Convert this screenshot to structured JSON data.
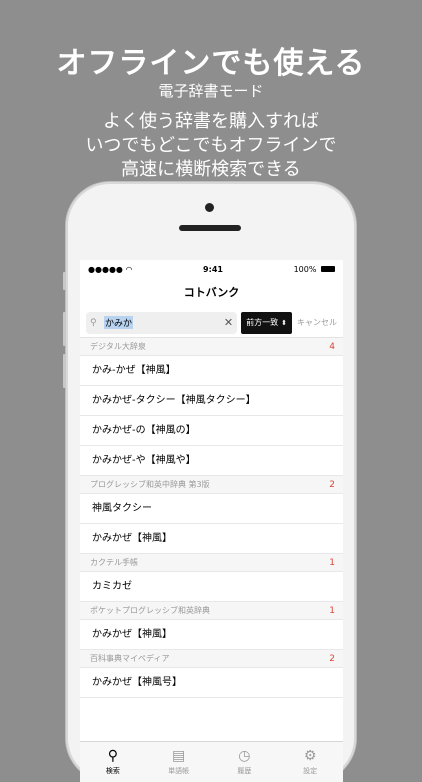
{
  "promo": {
    "headline": "オフラインでも使える",
    "subhead": "電子辞書モード",
    "desc_lines": [
      "よく使う辞書を購入すれば",
      "いつでもどこでもオフラインで",
      "高速に横断検索できる"
    ]
  },
  "status": {
    "time": "9:41",
    "battery": "100%"
  },
  "app": {
    "title": "コトバンク"
  },
  "search": {
    "query": "かみか",
    "mode": "前方一致",
    "cancel": "キャンセル"
  },
  "sections": [
    {
      "name": "デジタル大辞泉",
      "count": "4",
      "rows": [
        "かみ-かぜ【神風】",
        "かみかぜ-タクシー【神風タクシー】",
        "かみかぜ-の【神風の】",
        "かみかぜ-や【神風や】"
      ]
    },
    {
      "name": "プログレッシブ和英中辞典 第3版",
      "count": "2",
      "rows": [
        "神風タクシー",
        "かみかぜ【神風】"
      ]
    },
    {
      "name": "カクテル手帳",
      "count": "1",
      "rows": [
        "カミカゼ"
      ]
    },
    {
      "name": "ポケットプログレッシブ和英辞典",
      "count": "1",
      "rows": [
        "かみかぜ【神風】"
      ]
    },
    {
      "name": "百科事典マイペディア",
      "count": "2",
      "rows": [
        "かみかぜ【神風号】"
      ]
    }
  ],
  "tabs": [
    {
      "label": "検索",
      "icon": "search-icon",
      "glyph": "⚲"
    },
    {
      "label": "単語帳",
      "icon": "book-icon",
      "glyph": "▤"
    },
    {
      "label": "履歴",
      "icon": "history-icon",
      "glyph": "◷"
    },
    {
      "label": "設定",
      "icon": "gear-icon",
      "glyph": "⚙"
    }
  ],
  "colors": {
    "accent": "#d9463b",
    "background": "#8e8e8e"
  }
}
